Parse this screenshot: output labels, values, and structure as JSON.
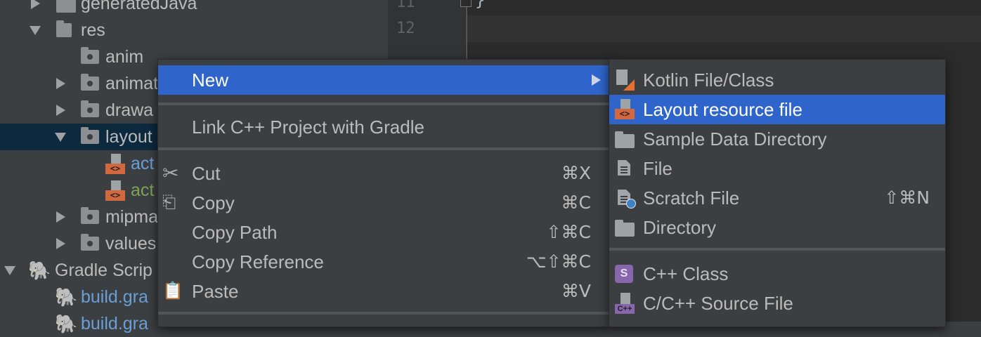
{
  "tree": {
    "rows": [
      {
        "label": "generatedJava",
        "color": "default"
      },
      {
        "label": "res",
        "color": "default"
      },
      {
        "label": "anim",
        "color": "default"
      },
      {
        "label": "animat",
        "color": "default"
      },
      {
        "label": "drawa",
        "color": "default"
      },
      {
        "label": "layout",
        "color": "default"
      },
      {
        "label": "act",
        "color": "blue"
      },
      {
        "label": "act",
        "color": "green"
      },
      {
        "label": "mipma",
        "color": "default"
      },
      {
        "label": "values",
        "color": "default"
      },
      {
        "label": "Gradle Scrip",
        "color": "default"
      },
      {
        "label": "build.gra",
        "color": "blue"
      },
      {
        "label": "build.gra",
        "color": "blue"
      }
    ]
  },
  "editor": {
    "line_numbers": [
      "11",
      "12"
    ],
    "code_brace": "}"
  },
  "context_menu": {
    "new": "New",
    "link_cpp": "Link C++ Project with Gradle",
    "cut": "Cut",
    "cut_shortcut": "⌘X",
    "copy": "Copy",
    "copy_shortcut": "⌘C",
    "copy_path": "Copy Path",
    "copy_path_shortcut": "⇧⌘C",
    "copy_reference": "Copy Reference",
    "copy_reference_shortcut": "⌥⇧⌘C",
    "paste": "Paste",
    "paste_shortcut": "⌘V"
  },
  "new_submenu": {
    "kotlin": "Kotlin File/Class",
    "layout_resource": "Layout resource file",
    "sample_data": "Sample Data Directory",
    "file": "File",
    "scratch": "Scratch File",
    "scratch_shortcut": "⇧⌘N",
    "directory": "Directory",
    "cpp_class": "C++ Class",
    "cpp_class_badge": "S",
    "cpp_source": "C/C++ Source File",
    "cpp_source_badge": "C++"
  },
  "icons": {
    "layout_tag": "<>",
    "cut": "scissors-icon",
    "copy": "copy-icon",
    "paste": "clipboard-icon"
  },
  "colors": {
    "highlight": "#2f65ca",
    "tree_selection": "#0d293e",
    "link_blue": "#6a9fd6",
    "link_green": "#7fa25a"
  }
}
